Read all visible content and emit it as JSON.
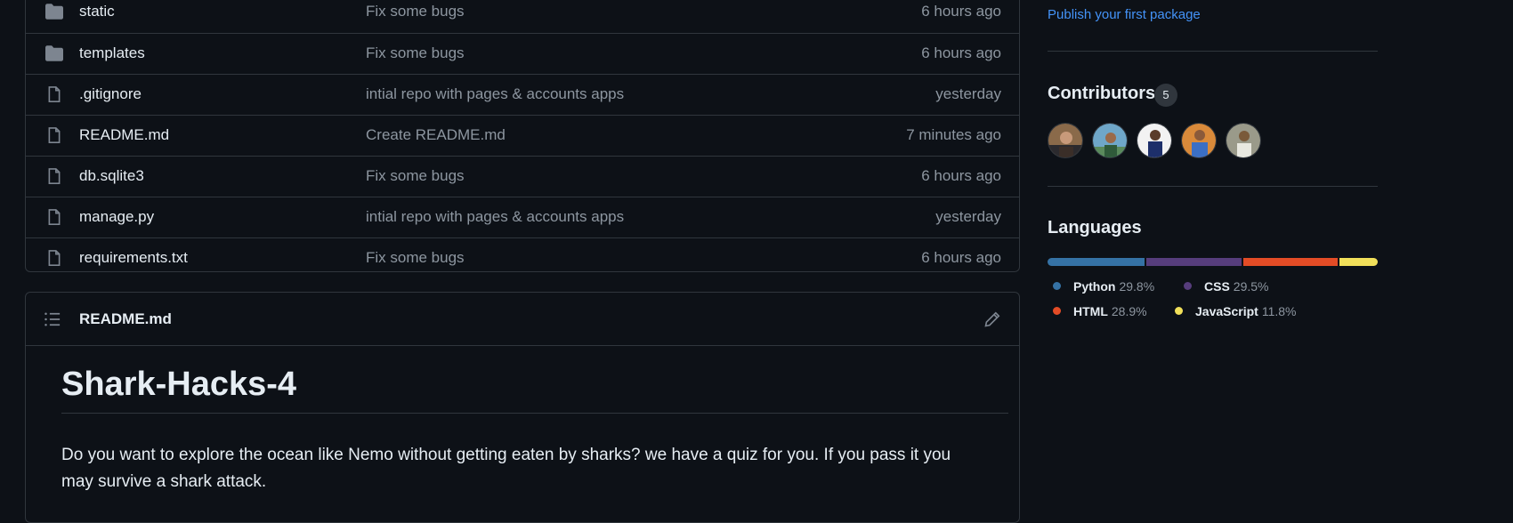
{
  "files": [
    {
      "name": "static",
      "message": "Fix some bugs",
      "date": "6 hours ago",
      "type": "folder"
    },
    {
      "name": "templates",
      "message": "Fix some bugs",
      "date": "6 hours ago",
      "type": "folder"
    },
    {
      "name": ".gitignore",
      "message": "intial repo with pages & accounts apps",
      "date": "yesterday",
      "type": "file"
    },
    {
      "name": "README.md",
      "message": "Create README.md",
      "date": "7 minutes ago",
      "type": "file"
    },
    {
      "name": "db.sqlite3",
      "message": "Fix some bugs",
      "date": "6 hours ago",
      "type": "file"
    },
    {
      "name": "manage.py",
      "message": "intial repo with pages & accounts apps",
      "date": "yesterday",
      "type": "file"
    },
    {
      "name": "requirements.txt",
      "message": "Fix some bugs",
      "date": "6 hours ago",
      "type": "file"
    }
  ],
  "readme": {
    "title": "README.md",
    "heading": "Shark-Hacks-4",
    "paragraph": "Do you want to explore the ocean like Nemo without getting eaten by sharks? we have a quiz for you. If you pass it you may survive a shark attack."
  },
  "sidebar": {
    "publish_link": "Publish your first package",
    "contributors_title": "Contributors",
    "contributors_count": "5",
    "languages_title": "Languages",
    "languages": [
      {
        "name": "Python",
        "percent": "29.8%",
        "value": 29.8,
        "color": "#3572A5"
      },
      {
        "name": "CSS",
        "percent": "29.5%",
        "value": 29.5,
        "color": "#563d7c"
      },
      {
        "name": "HTML",
        "percent": "28.9%",
        "value": 28.9,
        "color": "#e34c26"
      },
      {
        "name": "JavaScript",
        "percent": "11.8%",
        "value": 11.8,
        "color": "#f1e05a"
      }
    ]
  }
}
